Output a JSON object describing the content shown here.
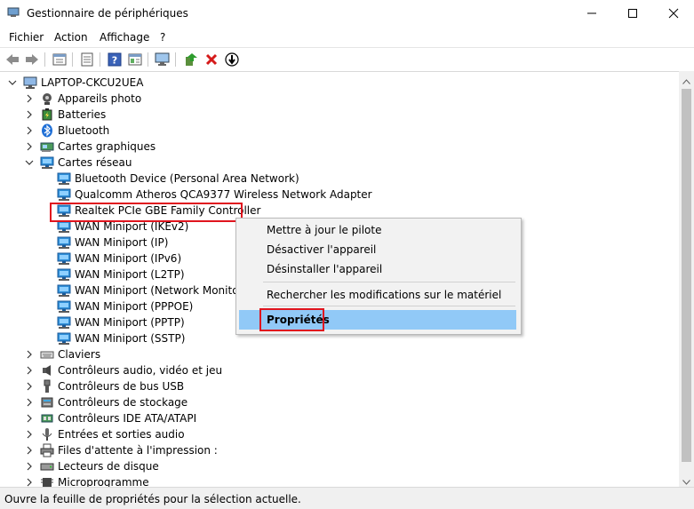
{
  "window": {
    "title": "Gestionnaire de périphériques"
  },
  "menu": [
    "Fichier",
    "Action",
    "Affichage",
    "?"
  ],
  "tree": {
    "root": "LAPTOP-CKCU2UEA",
    "items": [
      {
        "label": "Appareils photo",
        "level": 1,
        "expander": ">",
        "icon": "camera-icon"
      },
      {
        "label": "Batteries",
        "level": 1,
        "expander": ">",
        "icon": "battery-icon"
      },
      {
        "label": "Bluetooth",
        "level": 1,
        "expander": ">",
        "icon": "bluetooth-icon"
      },
      {
        "label": "Cartes graphiques",
        "level": 1,
        "expander": ">",
        "icon": "display-adapter-icon"
      },
      {
        "label": "Cartes réseau",
        "level": 1,
        "expander": "v",
        "icon": "network-adapter-icon"
      },
      {
        "label": "Bluetooth Device (Personal Area Network)",
        "level": 2,
        "expander": "",
        "icon": "network-adapter-icon"
      },
      {
        "label": "Qualcomm Atheros QCA9377 Wireless Network Adapter",
        "level": 2,
        "expander": "",
        "icon": "network-adapter-icon"
      },
      {
        "label": "Realtek PCIe GBE Family Controller",
        "level": 2,
        "expander": "",
        "icon": "network-adapter-icon"
      },
      {
        "label": "WAN Miniport (IKEv2)",
        "level": 2,
        "expander": "",
        "icon": "network-adapter-icon"
      },
      {
        "label": "WAN Miniport (IP)",
        "level": 2,
        "expander": "",
        "icon": "network-adapter-icon"
      },
      {
        "label": "WAN Miniport (IPv6)",
        "level": 2,
        "expander": "",
        "icon": "network-adapter-icon"
      },
      {
        "label": "WAN Miniport (L2TP)",
        "level": 2,
        "expander": "",
        "icon": "network-adapter-icon"
      },
      {
        "label": "WAN Miniport (Network Monitor)",
        "level": 2,
        "expander": "",
        "icon": "network-adapter-icon"
      },
      {
        "label": "WAN Miniport (PPPOE)",
        "level": 2,
        "expander": "",
        "icon": "network-adapter-icon"
      },
      {
        "label": "WAN Miniport (PPTP)",
        "level": 2,
        "expander": "",
        "icon": "network-adapter-icon"
      },
      {
        "label": "WAN Miniport (SSTP)",
        "level": 2,
        "expander": "",
        "icon": "network-adapter-icon"
      },
      {
        "label": "Claviers",
        "level": 1,
        "expander": ">",
        "icon": "keyboard-icon"
      },
      {
        "label": "Contrôleurs audio, vidéo et jeu",
        "level": 1,
        "expander": ">",
        "icon": "speaker-icon"
      },
      {
        "label": "Contrôleurs de bus USB",
        "level": 1,
        "expander": ">",
        "icon": "usb-icon"
      },
      {
        "label": "Contrôleurs de stockage",
        "level": 1,
        "expander": ">",
        "icon": "storage-controller-icon"
      },
      {
        "label": "Contrôleurs IDE ATA/ATAPI",
        "level": 1,
        "expander": ">",
        "icon": "ide-controller-icon"
      },
      {
        "label": "Entrées et sorties audio",
        "level": 1,
        "expander": ">",
        "icon": "audio-io-icon"
      },
      {
        "label": "Files d'attente à l'impression :",
        "level": 1,
        "expander": ">",
        "icon": "printer-icon"
      },
      {
        "label": "Lecteurs de disque",
        "level": 1,
        "expander": ">",
        "icon": "disk-drive-icon"
      },
      {
        "label": "Microprogramme",
        "level": 1,
        "expander": ">",
        "icon": "firmware-icon"
      }
    ]
  },
  "context_menu": {
    "items": [
      "Mettre à jour le pilote",
      "Désactiver l'appareil",
      "Désinstaller l'appareil",
      "Rechercher les modifications sur le matériel",
      "Propriétés"
    ]
  },
  "status": "Ouvre la feuille de propriétés pour la sélection actuelle.",
  "colors": {
    "highlight_border": "#e0141e",
    "menu_selection": "#91c9f7",
    "adapter_blue": "#2f8fd8"
  }
}
